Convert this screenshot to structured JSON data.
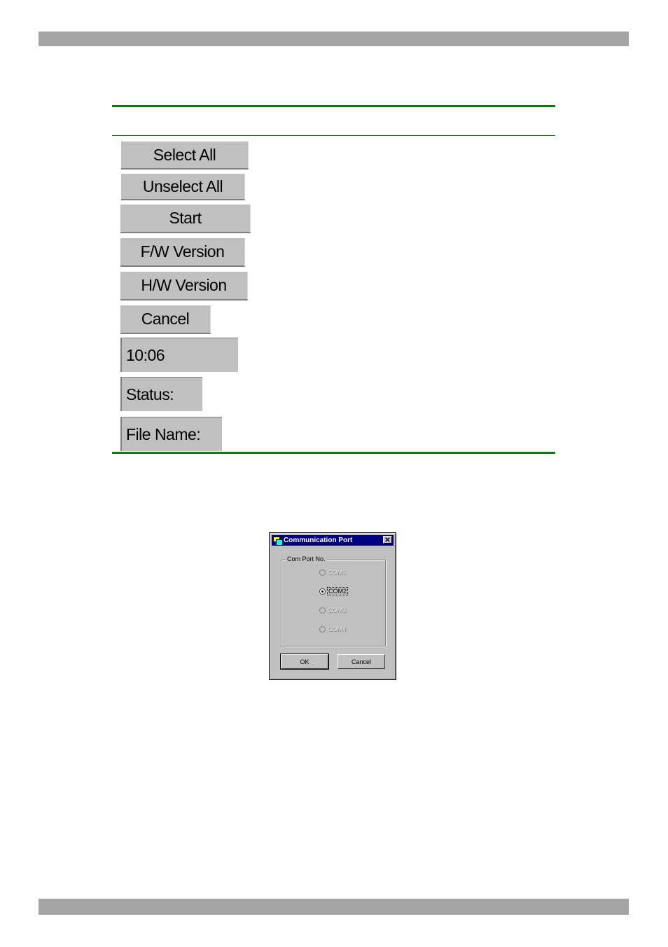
{
  "page": {
    "header_bar": "",
    "footer_bar": ""
  },
  "buttons_table": {
    "items": [
      {
        "label": "Select All"
      },
      {
        "label": "Unselect All"
      },
      {
        "label": "Start"
      },
      {
        "label": "F/W Version"
      },
      {
        "label": "H/W Version"
      },
      {
        "label": "Cancel"
      }
    ],
    "fields": [
      {
        "label": "10:06"
      },
      {
        "label": "Status:"
      },
      {
        "label": "File Name:"
      }
    ]
  },
  "dialog": {
    "title": "Communication Port",
    "close_glyph": "✕",
    "group_label": "Com Port No.",
    "options": [
      {
        "label": "COM1",
        "selected": false,
        "enabled": false
      },
      {
        "label": "COM2",
        "selected": true,
        "enabled": true
      },
      {
        "label": "COM3",
        "selected": false,
        "enabled": false
      },
      {
        "label": "COM4",
        "selected": false,
        "enabled": false
      }
    ],
    "ok_label": "OK",
    "cancel_label": "Cancel"
  },
  "colors": {
    "rule_green": "#0f7a0f",
    "bar_gray": "#a5a5a5",
    "button_gray": "#c0c0c0",
    "titlebar_navy": "#000080"
  }
}
